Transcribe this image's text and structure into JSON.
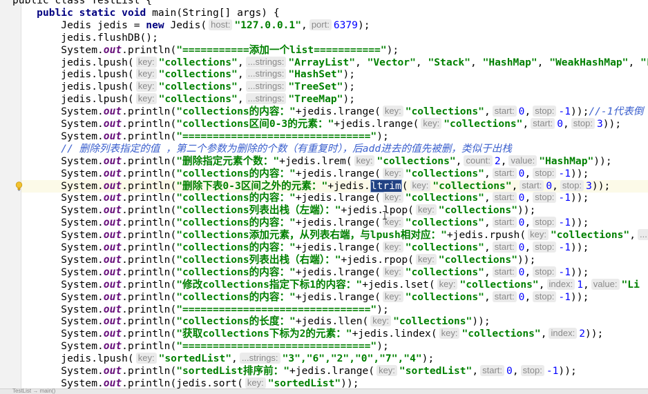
{
  "code_lines": [
    [
      [
        "public class TestList {",
        ""
      ]
    ],
    [
      [
        "    ",
        ""
      ],
      [
        "public static void ",
        "kw"
      ],
      [
        "main(String[] args) {",
        ""
      ]
    ],
    [
      [
        "        Jedis jedis = ",
        ""
      ],
      [
        "new ",
        "kw"
      ],
      [
        "Jedis(",
        ""
      ],
      [
        "host:",
        "hint"
      ],
      [
        "\"127.0.0.1\"",
        "str"
      ],
      [
        ",",
        ""
      ],
      [
        "port:",
        "hint"
      ],
      [
        "6379",
        "num"
      ],
      [
        ");",
        ""
      ]
    ],
    [
      [
        "        jedis.flushDB();",
        ""
      ]
    ],
    [
      [
        "        System.",
        ""
      ],
      [
        "out",
        "st"
      ],
      [
        ".println(",
        ""
      ],
      [
        "\"===========添加一个list===========\"",
        "str"
      ],
      [
        ");",
        ""
      ]
    ],
    [
      [
        "        jedis.lpush(",
        ""
      ],
      [
        "key:",
        "hint"
      ],
      [
        "\"collections\"",
        "str"
      ],
      [
        ",",
        ""
      ],
      [
        "...strings:",
        "hint"
      ],
      [
        "\"ArrayList\"",
        "str"
      ],
      [
        ", ",
        ""
      ],
      [
        "\"Vector\"",
        "str"
      ],
      [
        ", ",
        ""
      ],
      [
        "\"Stack\"",
        "str"
      ],
      [
        ", ",
        ""
      ],
      [
        "\"HashMap\"",
        "str"
      ],
      [
        ", ",
        ""
      ],
      [
        "\"WeakHashMap\"",
        "str"
      ],
      [
        ", ",
        ""
      ],
      [
        "\"Li",
        "str"
      ]
    ],
    [
      [
        "        jedis.lpush(",
        ""
      ],
      [
        "key:",
        "hint"
      ],
      [
        "\"collections\"",
        "str"
      ],
      [
        ",",
        ""
      ],
      [
        "...strings:",
        "hint"
      ],
      [
        "\"HashSet\"",
        "str"
      ],
      [
        ");",
        ""
      ]
    ],
    [
      [
        "        jedis.lpush(",
        ""
      ],
      [
        "key:",
        "hint"
      ],
      [
        "\"collections\"",
        "str"
      ],
      [
        ",",
        ""
      ],
      [
        "...strings:",
        "hint"
      ],
      [
        "\"TreeSet\"",
        "str"
      ],
      [
        ");",
        ""
      ]
    ],
    [
      [
        "        jedis.lpush(",
        ""
      ],
      [
        "key:",
        "hint"
      ],
      [
        "\"collections\"",
        "str"
      ],
      [
        ",",
        ""
      ],
      [
        "...strings:",
        "hint"
      ],
      [
        "\"TreeMap\"",
        "str"
      ],
      [
        ");",
        ""
      ]
    ],
    [
      [
        "        System.",
        ""
      ],
      [
        "out",
        "st"
      ],
      [
        ".println(",
        ""
      ],
      [
        "\"collections的内容：\"",
        "str"
      ],
      [
        "+jedis.lrange(",
        ""
      ],
      [
        "key:",
        "hint"
      ],
      [
        "\"collections\"",
        "str"
      ],
      [
        ",",
        ""
      ],
      [
        "start:",
        "hint"
      ],
      [
        "0",
        "num"
      ],
      [
        ",",
        ""
      ],
      [
        "stop:",
        "hint"
      ],
      [
        "-1",
        "num"
      ],
      [
        "));",
        ""
      ],
      [
        "//-1代表倒",
        "cm"
      ]
    ],
    [
      [
        "        System.",
        ""
      ],
      [
        "out",
        "st"
      ],
      [
        ".println(",
        ""
      ],
      [
        "\"collections区间0-3的元素：\"",
        "str"
      ],
      [
        "+jedis.lrange(",
        ""
      ],
      [
        "key:",
        "hint"
      ],
      [
        "\"collections\"",
        "str"
      ],
      [
        ",",
        ""
      ],
      [
        "start:",
        "hint"
      ],
      [
        "0",
        "num"
      ],
      [
        ",",
        ""
      ],
      [
        "stop:",
        "hint"
      ],
      [
        "3",
        "num"
      ],
      [
        "));",
        ""
      ]
    ],
    [
      [
        "        System.",
        ""
      ],
      [
        "out",
        "st"
      ],
      [
        ".println(",
        ""
      ],
      [
        "\"===============================\"",
        "str"
      ],
      [
        ");",
        ""
      ]
    ],
    [
      [
        "        ",
        ""
      ],
      [
        "// 删除列表指定的值 ，第二个参数为删除的个数（有重复时），后add进去的值先被删，类似于出栈",
        "cm"
      ]
    ],
    [
      [
        "        System.",
        ""
      ],
      [
        "out",
        "st"
      ],
      [
        ".println(",
        ""
      ],
      [
        "\"删除指定元素个数：\"",
        "str"
      ],
      [
        "+jedis.lrem(",
        ""
      ],
      [
        "key:",
        "hint"
      ],
      [
        "\"collections\"",
        "str"
      ],
      [
        ",",
        ""
      ],
      [
        "count:",
        "hint"
      ],
      [
        "2",
        "num"
      ],
      [
        ",",
        ""
      ],
      [
        "value:",
        "hint"
      ],
      [
        "\"HashMap\"",
        "str"
      ],
      [
        "));",
        ""
      ]
    ],
    [
      [
        "        System.",
        ""
      ],
      [
        "out",
        "st"
      ],
      [
        ".println(",
        ""
      ],
      [
        "\"collections的内容：\"",
        "str"
      ],
      [
        "+jedis.lrange(",
        ""
      ],
      [
        "key:",
        "hint"
      ],
      [
        "\"collections\"",
        "str"
      ],
      [
        ",",
        ""
      ],
      [
        "start:",
        "hint"
      ],
      [
        "0",
        "num"
      ],
      [
        ",",
        ""
      ],
      [
        "stop:",
        "hint"
      ],
      [
        "-1",
        "num"
      ],
      [
        "));",
        ""
      ]
    ],
    [
      [
        "        System.",
        ""
      ],
      [
        "out",
        "st"
      ],
      [
        ".println(",
        ""
      ],
      [
        "\"删除下表0-3区间之外的元素：\"",
        "str"
      ],
      [
        "+jedis.",
        ""
      ],
      [
        "ltrim",
        "sel"
      ],
      [
        "(",
        ""
      ],
      [
        "key:",
        "hint"
      ],
      [
        "\"collections\"",
        "str"
      ],
      [
        ",",
        ""
      ],
      [
        "start:",
        "hint"
      ],
      [
        "0",
        "num"
      ],
      [
        ",",
        ""
      ],
      [
        "stop:",
        "hint"
      ],
      [
        "3",
        "num"
      ],
      [
        "));",
        ""
      ]
    ],
    [
      [
        "        System.",
        ""
      ],
      [
        "out",
        "st"
      ],
      [
        ".println(",
        ""
      ],
      [
        "\"collections的内容：\"",
        "str"
      ],
      [
        "+jedis.lrange(",
        ""
      ],
      [
        "key:",
        "hint"
      ],
      [
        "\"collections\"",
        "str"
      ],
      [
        ",",
        ""
      ],
      [
        "start:",
        "hint"
      ],
      [
        "0",
        "num"
      ],
      [
        ",",
        ""
      ],
      [
        "stop:",
        "hint"
      ],
      [
        "-1",
        "num"
      ],
      [
        "));",
        ""
      ]
    ],
    [
      [
        "        System.",
        ""
      ],
      [
        "out",
        "st"
      ],
      [
        ".println(",
        ""
      ],
      [
        "\"collections列表出栈（左端）：\"",
        "str"
      ],
      [
        "+jedis.lpop(",
        ""
      ],
      [
        "key:",
        "hint"
      ],
      [
        "\"collections\"",
        "str"
      ],
      [
        "));",
        ""
      ]
    ],
    [
      [
        "        System.",
        ""
      ],
      [
        "out",
        "st"
      ],
      [
        ".println(",
        ""
      ],
      [
        "\"collections的内容：\"",
        "str"
      ],
      [
        "+jedis.lrange(",
        ""
      ],
      [
        "key:",
        "hint"
      ],
      [
        "\"collections\"",
        "str"
      ],
      [
        ",",
        ""
      ],
      [
        "start:",
        "hint"
      ],
      [
        "0",
        "num"
      ],
      [
        ",",
        ""
      ],
      [
        "stop:",
        "hint"
      ],
      [
        "-1",
        "num"
      ],
      [
        "));",
        ""
      ]
    ],
    [
      [
        "        System.",
        ""
      ],
      [
        "out",
        "st"
      ],
      [
        ".println(",
        ""
      ],
      [
        "\"collections添加元素，从列表右端，与lpush相对应：\"",
        "str"
      ],
      [
        "+jedis.rpush(",
        ""
      ],
      [
        "key:",
        "hint"
      ],
      [
        "\"collections\"",
        "str"
      ],
      [
        ",",
        ""
      ],
      [
        "...",
        "hint"
      ]
    ],
    [
      [
        "        System.",
        ""
      ],
      [
        "out",
        "st"
      ],
      [
        ".println(",
        ""
      ],
      [
        "\"collections的内容：\"",
        "str"
      ],
      [
        "+jedis.lrange(",
        ""
      ],
      [
        "key:",
        "hint"
      ],
      [
        "\"collections\"",
        "str"
      ],
      [
        ",",
        ""
      ],
      [
        "start:",
        "hint"
      ],
      [
        "0",
        "num"
      ],
      [
        ",",
        ""
      ],
      [
        "stop:",
        "hint"
      ],
      [
        "-1",
        "num"
      ],
      [
        "));",
        ""
      ]
    ],
    [
      [
        "        System.",
        ""
      ],
      [
        "out",
        "st"
      ],
      [
        ".println(",
        ""
      ],
      [
        "\"collections列表出栈（右端）：\"",
        "str"
      ],
      [
        "+jedis.rpop(",
        ""
      ],
      [
        "key:",
        "hint"
      ],
      [
        "\"collections\"",
        "str"
      ],
      [
        "));",
        ""
      ]
    ],
    [
      [
        "        System.",
        ""
      ],
      [
        "out",
        "st"
      ],
      [
        ".println(",
        ""
      ],
      [
        "\"collections的内容：\"",
        "str"
      ],
      [
        "+jedis.lrange(",
        ""
      ],
      [
        "key:",
        "hint"
      ],
      [
        "\"collections\"",
        "str"
      ],
      [
        ",",
        ""
      ],
      [
        "start:",
        "hint"
      ],
      [
        "0",
        "num"
      ],
      [
        ",",
        ""
      ],
      [
        "stop:",
        "hint"
      ],
      [
        "-1",
        "num"
      ],
      [
        "));",
        ""
      ]
    ],
    [
      [
        "        System.",
        ""
      ],
      [
        "out",
        "st"
      ],
      [
        ".println(",
        ""
      ],
      [
        "\"修改collections指定下标1的内容：\"",
        "str"
      ],
      [
        "+jedis.lset(",
        ""
      ],
      [
        "key:",
        "hint"
      ],
      [
        "\"collections\"",
        "str"
      ],
      [
        ",",
        ""
      ],
      [
        "index:",
        "hint"
      ],
      [
        "1",
        "num"
      ],
      [
        ",",
        ""
      ],
      [
        "value:",
        "hint"
      ],
      [
        "\"Li",
        "str"
      ]
    ],
    [
      [
        "        System.",
        ""
      ],
      [
        "out",
        "st"
      ],
      [
        ".println(",
        ""
      ],
      [
        "\"collections的内容：\"",
        "str"
      ],
      [
        "+jedis.lrange(",
        ""
      ],
      [
        "key:",
        "hint"
      ],
      [
        "\"collections\"",
        "str"
      ],
      [
        ",",
        ""
      ],
      [
        "start:",
        "hint"
      ],
      [
        "0",
        "num"
      ],
      [
        ",",
        ""
      ],
      [
        "stop:",
        "hint"
      ],
      [
        "-1",
        "num"
      ],
      [
        "));",
        ""
      ]
    ],
    [
      [
        "        System.",
        ""
      ],
      [
        "out",
        "st"
      ],
      [
        ".println(",
        ""
      ],
      [
        "\"===============================\"",
        "str"
      ],
      [
        ");",
        ""
      ]
    ],
    [
      [
        "        System.",
        ""
      ],
      [
        "out",
        "st"
      ],
      [
        ".println(",
        ""
      ],
      [
        "\"collections的长度：\"",
        "str"
      ],
      [
        "+jedis.llen(",
        ""
      ],
      [
        "key:",
        "hint"
      ],
      [
        "\"collections\"",
        "str"
      ],
      [
        "));",
        ""
      ]
    ],
    [
      [
        "        System.",
        ""
      ],
      [
        "out",
        "st"
      ],
      [
        ".println(",
        ""
      ],
      [
        "\"获取collections下标为2的元素：\"",
        "str"
      ],
      [
        "+jedis.lindex(",
        ""
      ],
      [
        "key:",
        "hint"
      ],
      [
        "\"collections\"",
        "str"
      ],
      [
        ",",
        ""
      ],
      [
        "index:",
        "hint"
      ],
      [
        "2",
        "num"
      ],
      [
        "));",
        ""
      ]
    ],
    [
      [
        "        System.",
        ""
      ],
      [
        "out",
        "st"
      ],
      [
        ".println(",
        ""
      ],
      [
        "\"===============================\"",
        "str"
      ],
      [
        ");",
        ""
      ]
    ],
    [
      [
        "        jedis.lpush(",
        ""
      ],
      [
        "key:",
        "hint"
      ],
      [
        "\"sortedList\"",
        "str"
      ],
      [
        ",",
        ""
      ],
      [
        "...strings:",
        "hint"
      ],
      [
        "\"3\",\"6\",\"2\",\"0\",\"7\",\"4\"",
        "str"
      ],
      [
        ");",
        ""
      ]
    ],
    [
      [
        "        System.",
        ""
      ],
      [
        "out",
        "st"
      ],
      [
        ".println(",
        ""
      ],
      [
        "\"sortedList排序前：\"",
        "str"
      ],
      [
        "+jedis.lrange(",
        ""
      ],
      [
        "key:",
        "hint"
      ],
      [
        "\"sortedList\"",
        "str"
      ],
      [
        ",",
        ""
      ],
      [
        "start:",
        "hint"
      ],
      [
        "0",
        "num"
      ],
      [
        ",",
        ""
      ],
      [
        "stop:",
        "hint"
      ],
      [
        "-1",
        "num"
      ],
      [
        "));",
        ""
      ]
    ],
    [
      [
        "        System.",
        ""
      ],
      [
        "out",
        "st"
      ],
      [
        ".println(jedis.sort(",
        ""
      ],
      [
        "key:",
        "hint"
      ],
      [
        "\"sortedList\"",
        "str"
      ],
      [
        "));",
        ""
      ]
    ]
  ],
  "statusbar": {
    "text": "TestList → main()"
  },
  "colors": {
    "keyword": "#000080",
    "string": "#008000",
    "number": "#0000ff",
    "static_field": "#660e7a",
    "comment": "#3a5fcd",
    "hint_bg": "#ebebeb",
    "selection": "#214283"
  }
}
